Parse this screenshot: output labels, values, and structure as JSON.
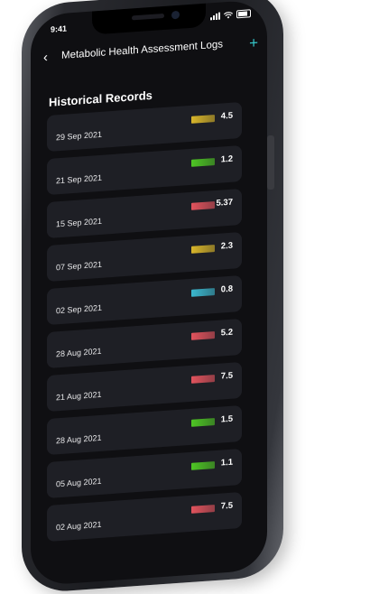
{
  "status_bar": {
    "time": "9:41"
  },
  "header": {
    "title": "Metabolic Health Assessment Logs"
  },
  "section_title": "Historical Records",
  "records": [
    {
      "date": "29 Sep 2021",
      "value": "4.5",
      "color": "#d9b62a"
    },
    {
      "date": "21 Sep 2021",
      "value": "1.2",
      "color": "#4ec624"
    },
    {
      "date": "15 Sep 2021",
      "value": "5.37",
      "color": "#e2535d"
    },
    {
      "date": "07 Sep 2021",
      "value": "2.3",
      "color": "#d9b62a"
    },
    {
      "date": "02 Sep 2021",
      "value": "0.8",
      "color": "#3bb8cf"
    },
    {
      "date": "28 Aug 2021",
      "value": "5.2",
      "color": "#e2535d"
    },
    {
      "date": "21 Aug 2021",
      "value": "7.5",
      "color": "#e2535d"
    },
    {
      "date": "28 Aug 2021",
      "value": "1.5",
      "color": "#4ec624"
    },
    {
      "date": "05 Aug 2021",
      "value": "1.1",
      "color": "#4ec624"
    },
    {
      "date": "02 Aug 2021",
      "value": "7.5",
      "color": "#e2535d"
    }
  ]
}
